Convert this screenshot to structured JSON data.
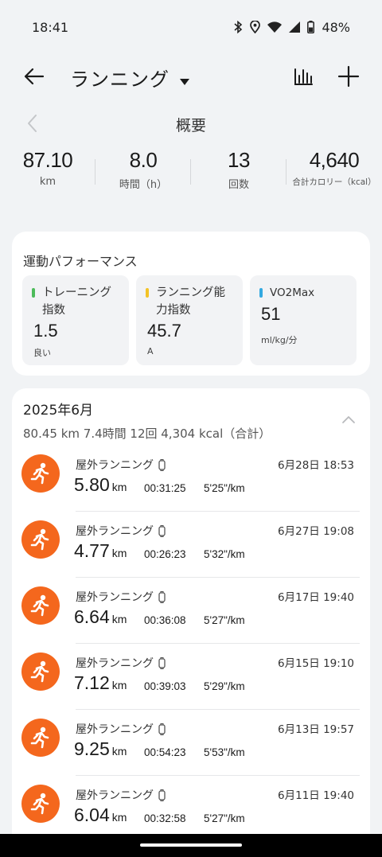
{
  "status_bar": {
    "time": "18:41",
    "battery": "48%",
    "icons": [
      "bluetooth-icon",
      "location-icon",
      "wifi-icon",
      "signal-icon",
      "battery-icon"
    ]
  },
  "app_bar": {
    "title": "ランニング"
  },
  "summary": {
    "label": "概要",
    "stats": [
      {
        "value": "87.10",
        "unit": "km"
      },
      {
        "value": "8.0",
        "unit": "時間（h）"
      },
      {
        "value": "13",
        "unit": "回数"
      },
      {
        "value": "4,640",
        "unit": "合計カロリー（kcal）"
      }
    ]
  },
  "performance": {
    "title": "運動パフォーマンス",
    "tiles": [
      {
        "name": "トレーニング指数",
        "value": "1.5",
        "sub": "良い",
        "color": "#4cbb5a"
      },
      {
        "name": "ランニング能力指数",
        "value": "45.7",
        "sub": "A",
        "color": "#f3c326"
      },
      {
        "name": "VO2Max",
        "value": "51",
        "sub": "ml/kg/分",
        "color": "#33a9e0"
      }
    ]
  },
  "month": {
    "title": "2025年6月",
    "summary": "80.45 km  7.4時間  12回  4,304 kcal（合計）",
    "accent": "#f4671d",
    "activities": [
      {
        "type": "屋外ランニング",
        "date": "6月28日 18:53",
        "distance": "5.80",
        "unit": "km",
        "duration": "00:31:25",
        "pace": "5'25\"/km"
      },
      {
        "type": "屋外ランニング",
        "date": "6月27日 19:08",
        "distance": "4.77",
        "unit": "km",
        "duration": "00:26:23",
        "pace": "5'32\"/km"
      },
      {
        "type": "屋外ランニング",
        "date": "6月17日 19:40",
        "distance": "6.64",
        "unit": "km",
        "duration": "00:36:08",
        "pace": "5'27\"/km"
      },
      {
        "type": "屋外ランニング",
        "date": "6月15日 19:10",
        "distance": "7.12",
        "unit": "km",
        "duration": "00:39:03",
        "pace": "5'29\"/km"
      },
      {
        "type": "屋外ランニング",
        "date": "6月13日 19:57",
        "distance": "9.25",
        "unit": "km",
        "duration": "00:54:23",
        "pace": "5'53\"/km"
      },
      {
        "type": "屋外ランニング",
        "date": "6月11日 19:40",
        "distance": "6.04",
        "unit": "km",
        "duration": "00:32:58",
        "pace": "5'27\"/km"
      }
    ]
  }
}
